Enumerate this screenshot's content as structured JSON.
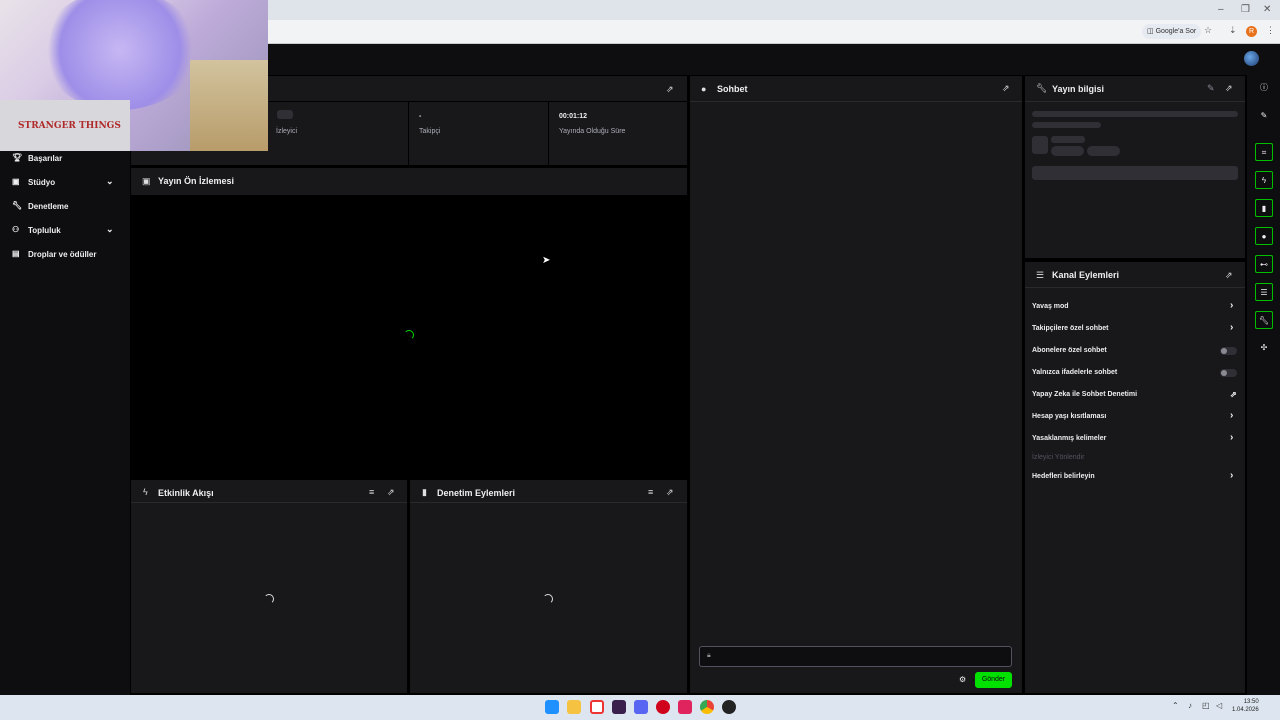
{
  "browser": {
    "google_ask_label": "Google'a Sor",
    "profile_initial": "R",
    "window_controls": [
      "–",
      "❐",
      "✕"
    ]
  },
  "sidebar": {
    "items": [
      {
        "label": "Başarılar",
        "icon": "trophy-icon",
        "has_chevron": false
      },
      {
        "label": "Stüdyo",
        "icon": "studio-icon",
        "has_chevron": true
      },
      {
        "label": "Denetleme",
        "icon": "wrench-icon",
        "has_chevron": false
      },
      {
        "label": "Topluluk",
        "icon": "community-icon",
        "has_chevron": true
      },
      {
        "label": "Droplar ve ödüller",
        "icon": "gift-icon",
        "has_chevron": false
      }
    ]
  },
  "webcam": {
    "shirt_text": "STRANGER THINGS"
  },
  "stats": {
    "viewers": {
      "value": "",
      "label": "İzleyici"
    },
    "followers": {
      "value": "-",
      "label": "Takipçi"
    },
    "uptime": {
      "value": "00:01:12",
      "label": "Yayında Olduğu Süre"
    }
  },
  "preview": {
    "title": "Yayın Ön İzlemesi"
  },
  "activity_feed": {
    "title": "Etkinlik Akışı"
  },
  "mod_actions": {
    "title": "Denetim Eylemleri"
  },
  "chat": {
    "title": "Sohbet",
    "input_placeholder": "",
    "send_label": "Gönder"
  },
  "stream_info": {
    "title": "Yayın bilgisi"
  },
  "channel_actions": {
    "title": "Kanal Eylemleri",
    "items": [
      {
        "label": "Yavaş mod",
        "control": "arrow"
      },
      {
        "label": "Takipçilere özel sohbet",
        "control": "arrow"
      },
      {
        "label": "Abonelere özel sohbet",
        "control": "toggle",
        "enabled": false
      },
      {
        "label": "Yalnızca ifadelerle sohbet",
        "control": "toggle",
        "enabled": false
      },
      {
        "label": "Yapay Zeka ile Sohbet Denetimi",
        "control": "external"
      },
      {
        "label": "Hesap yaşı kısıtlaması",
        "control": "arrow"
      },
      {
        "label": "Yasaklanmış kelimeler",
        "control": "arrow"
      }
    ],
    "section_label": "İzleyici Yönlendir",
    "targets_label": "Hedefleri belirleyin"
  },
  "taskbar": {
    "time": "13:50",
    "date": "1.04.2026"
  },
  "colors": {
    "accent": "#00e100",
    "panel_bg": "#18181b",
    "page_bg": "#0e0e10"
  }
}
